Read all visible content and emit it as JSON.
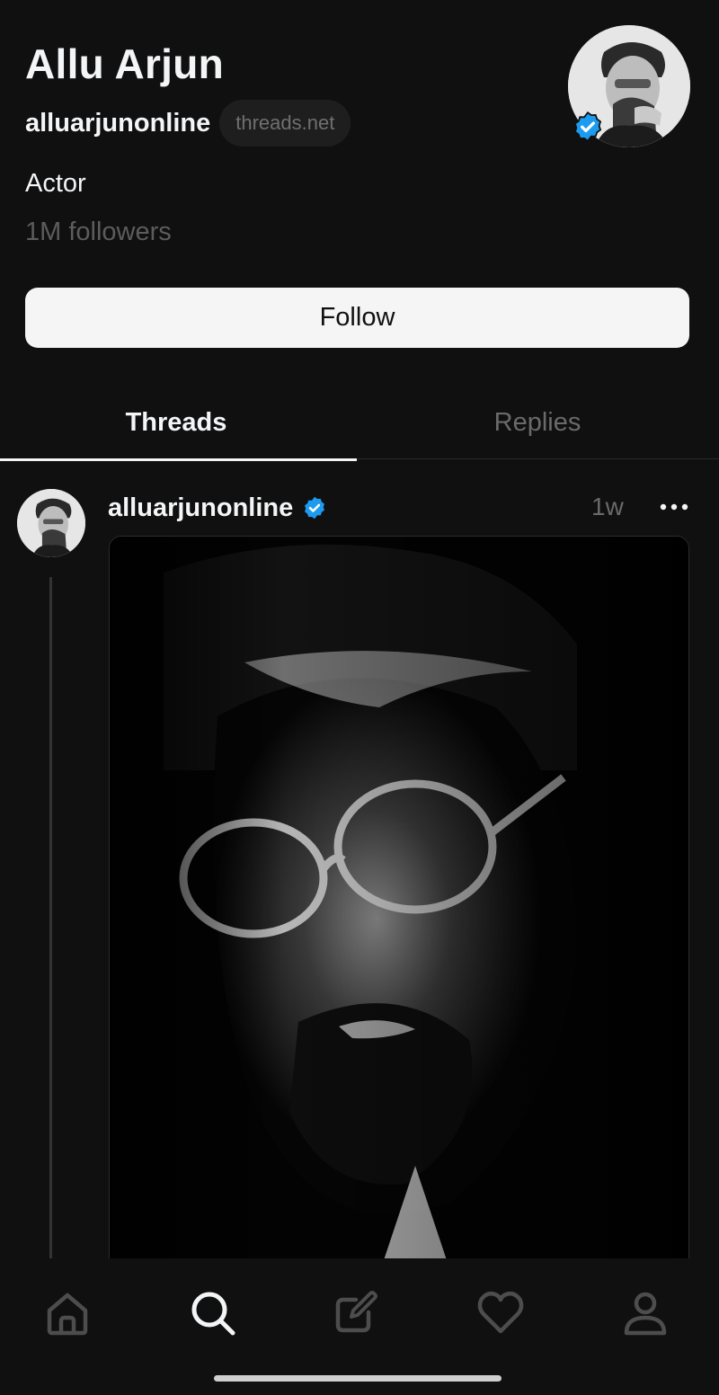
{
  "profile": {
    "name": "Allu Arjun",
    "handle": "alluarjunonline",
    "domain": "threads.net",
    "bio": "Actor",
    "followers": "1M followers",
    "verified": true
  },
  "actions": {
    "follow_label": "Follow"
  },
  "tabs": [
    {
      "label": "Threads",
      "active": true
    },
    {
      "label": "Replies",
      "active": false
    }
  ],
  "post": {
    "handle": "alluarjunonline",
    "time": "1w",
    "verified": true
  },
  "nav": {
    "items": [
      {
        "icon": "home-icon",
        "active": false
      },
      {
        "icon": "search-icon",
        "active": true
      },
      {
        "icon": "compose-icon",
        "active": false
      },
      {
        "icon": "heart-icon",
        "active": false
      },
      {
        "icon": "profile-icon",
        "active": false
      }
    ]
  },
  "colors": {
    "background": "#101010",
    "verified_blue": "#1d9bf0",
    "muted_text": "#6a6a6a"
  }
}
